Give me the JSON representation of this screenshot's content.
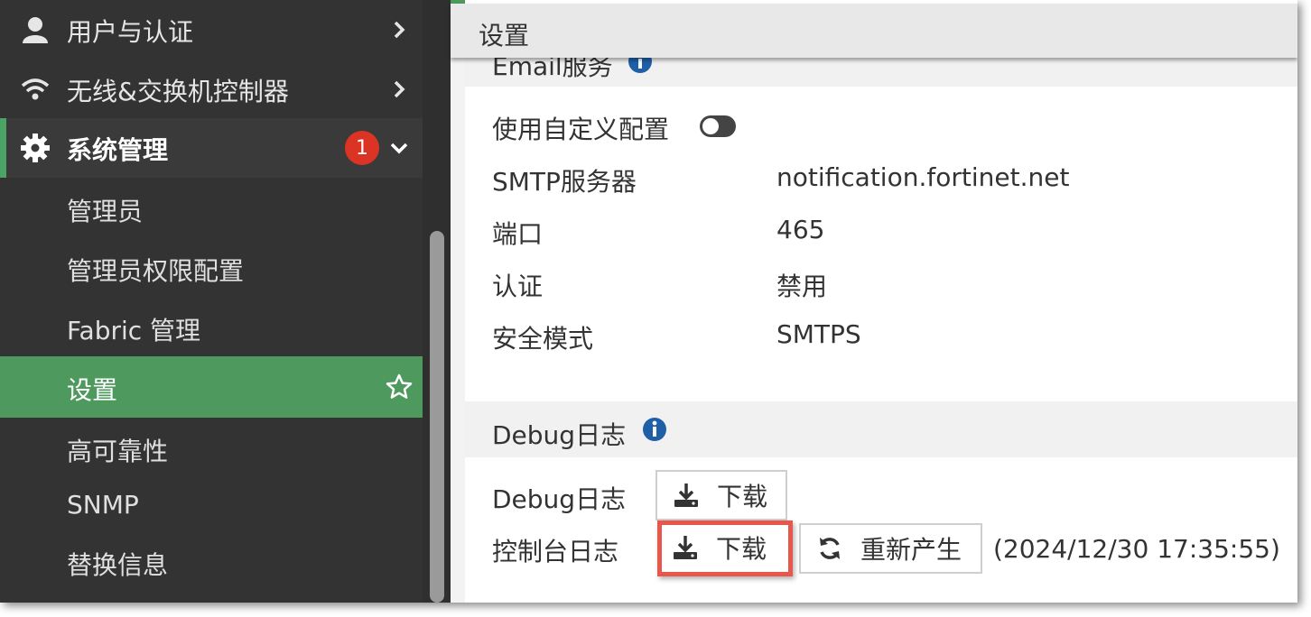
{
  "sidebar": {
    "items": [
      {
        "label": "用户与认证",
        "icon": "user-icon"
      },
      {
        "label": "无线&交换机控制器",
        "icon": "wifi-icon"
      },
      {
        "label": "系统管理",
        "icon": "gear-icon",
        "badge": "1"
      },
      {
        "label": "管理员"
      },
      {
        "label": "管理员权限配置"
      },
      {
        "label": "Fabric 管理"
      },
      {
        "label": "设置",
        "active": true
      },
      {
        "label": "高可靠性"
      },
      {
        "label": "SNMP"
      },
      {
        "label": "替换信息"
      }
    ]
  },
  "header": {
    "title": "设置"
  },
  "email_section": {
    "title": "Email服务",
    "custom_config_label": "使用自定义配置",
    "custom_config_enabled": false,
    "smtp_label": "SMTP服务器",
    "smtp_value": "notification.fortinet.net",
    "port_label": "端口",
    "port_value": "465",
    "auth_label": "认证",
    "auth_value": "禁用",
    "security_label": "安全模式",
    "security_value": "SMTPS"
  },
  "debug_section": {
    "title": "Debug日志",
    "debug_log_label": "Debug日志",
    "debug_download_label": "下载",
    "console_log_label": "控制台日志",
    "console_download_label": "下载",
    "regenerate_label": "重新产生",
    "timestamp": "(2024/12/30 17:35:55)"
  },
  "colors": {
    "sidebar_bg": "#333333",
    "accent_green": "#4e9a5e",
    "badge_red": "#db3324",
    "info_blue": "#1f5fa8",
    "highlight_red": "#e8574b"
  }
}
